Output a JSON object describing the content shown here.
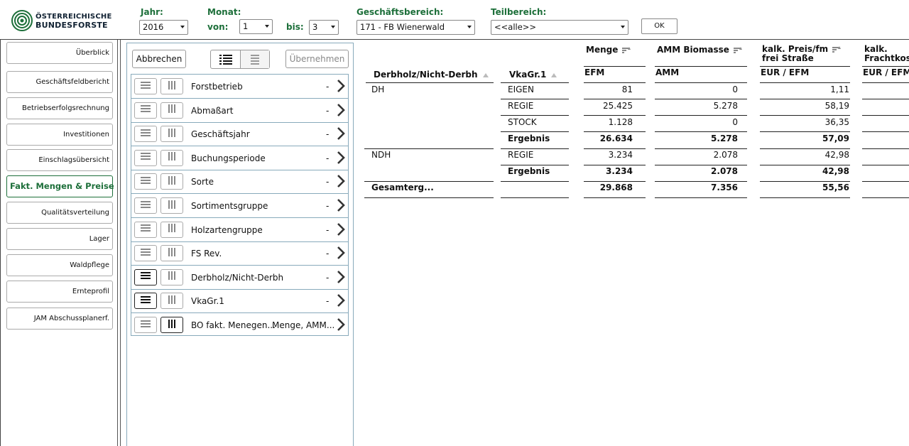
{
  "brand": {
    "line1": "ÖSTERREICHISCHE",
    "line2": "BUNDESFORSTE"
  },
  "filters": {
    "year": {
      "label": "Jahr:",
      "value": "2016"
    },
    "month": {
      "label": "Monat:",
      "from_label": "von:",
      "from_value": "1",
      "to_label": "bis:",
      "to_value": "3"
    },
    "business": {
      "label": "Geschäftsbereich:",
      "value": "171 - FB Wienerwald"
    },
    "sub": {
      "label": "Teilbereich:",
      "value": "<<alle>>"
    },
    "ok_label": "OK"
  },
  "nav": {
    "items": [
      {
        "label": "Überblick"
      },
      {
        "label": "Geschäftsfeldbericht"
      },
      {
        "label": "Betriebserfolgsrechnung"
      },
      {
        "label": "Investitionen"
      },
      {
        "label": "Einschlagsübersicht"
      },
      {
        "label": "Fakt. Mengen & Preise",
        "active": true
      },
      {
        "label": "Qualitätsverteilung"
      },
      {
        "label": "Lager"
      },
      {
        "label": "Waldpflege"
      },
      {
        "label": "Ernteprofil"
      },
      {
        "label": "JAM Abschussplanerf."
      }
    ]
  },
  "panel": {
    "cancel_label": "Abbrechen",
    "apply_label": "Übernehmen",
    "dimensions": [
      {
        "name": "Forstbetrieb",
        "value": "-",
        "rows_on": false,
        "cols_on": false
      },
      {
        "name": "Abmaßart",
        "value": "-",
        "rows_on": false,
        "cols_on": false
      },
      {
        "name": "Geschäftsjahr",
        "value": "-",
        "rows_on": false,
        "cols_on": false
      },
      {
        "name": "Buchungsperiode",
        "value": "-",
        "rows_on": false,
        "cols_on": false
      },
      {
        "name": "Sorte",
        "value": "-",
        "rows_on": false,
        "cols_on": false
      },
      {
        "name": "Sortimentsgruppe",
        "value": "-",
        "rows_on": false,
        "cols_on": false
      },
      {
        "name": "Holzartengruppe",
        "value": "-",
        "rows_on": false,
        "cols_on": false
      },
      {
        "name": "FS Rev.",
        "value": "-",
        "rows_on": false,
        "cols_on": false
      },
      {
        "name": "Derbholz/Nicht-Derbh",
        "value": "-",
        "rows_on": true,
        "cols_on": false
      },
      {
        "name": "VkaGr.1",
        "value": "-",
        "rows_on": true,
        "cols_on": false
      },
      {
        "name": "BO fakt. Menegen...",
        "value": "Menge, AMM...",
        "rows_on": false,
        "cols_on": true
      }
    ]
  },
  "table": {
    "row_headers": [
      "Derbholz/Nicht-Derbh",
      "VkaGr.1"
    ],
    "measures": [
      {
        "name": "Menge",
        "unit": "EFM"
      },
      {
        "name": "AMM Biomasse",
        "unit": "AMM"
      },
      {
        "name": "kalk. Preis/fm frei Straße",
        "name_line1": "kalk. Preis/fm",
        "name_line2": "frei Straße",
        "unit": "EUR / EFM"
      },
      {
        "name": "kalk. Frachtkost",
        "name_line1": "kalk.",
        "name_line2": "Frachtkost",
        "unit": "EUR / EFM"
      }
    ],
    "rows": [
      {
        "g": "DH",
        "k": "EIGEN",
        "v": [
          "81",
          "0",
          "1,11"
        ],
        "bold": false
      },
      {
        "g": "",
        "k": "REGIE",
        "v": [
          "25.425",
          "5.278",
          "58,19"
        ],
        "bold": false
      },
      {
        "g": "",
        "k": "STOCK",
        "v": [
          "1.128",
          "0",
          "36,35"
        ],
        "bold": false
      },
      {
        "g": "",
        "k": "Ergebnis",
        "v": [
          "26.634",
          "5.278",
          "57,09"
        ],
        "bold": true
      },
      {
        "g": "NDH",
        "k": "REGIE",
        "v": [
          "3.234",
          "2.078",
          "42,98"
        ],
        "bold": false
      },
      {
        "g": "",
        "k": "Ergebnis",
        "v": [
          "3.234",
          "2.078",
          "42,98"
        ],
        "bold": true
      },
      {
        "g": "Gesamterg...",
        "k": "",
        "v": [
          "29.868",
          "7.356",
          "55,56"
        ],
        "bold": true
      }
    ]
  }
}
